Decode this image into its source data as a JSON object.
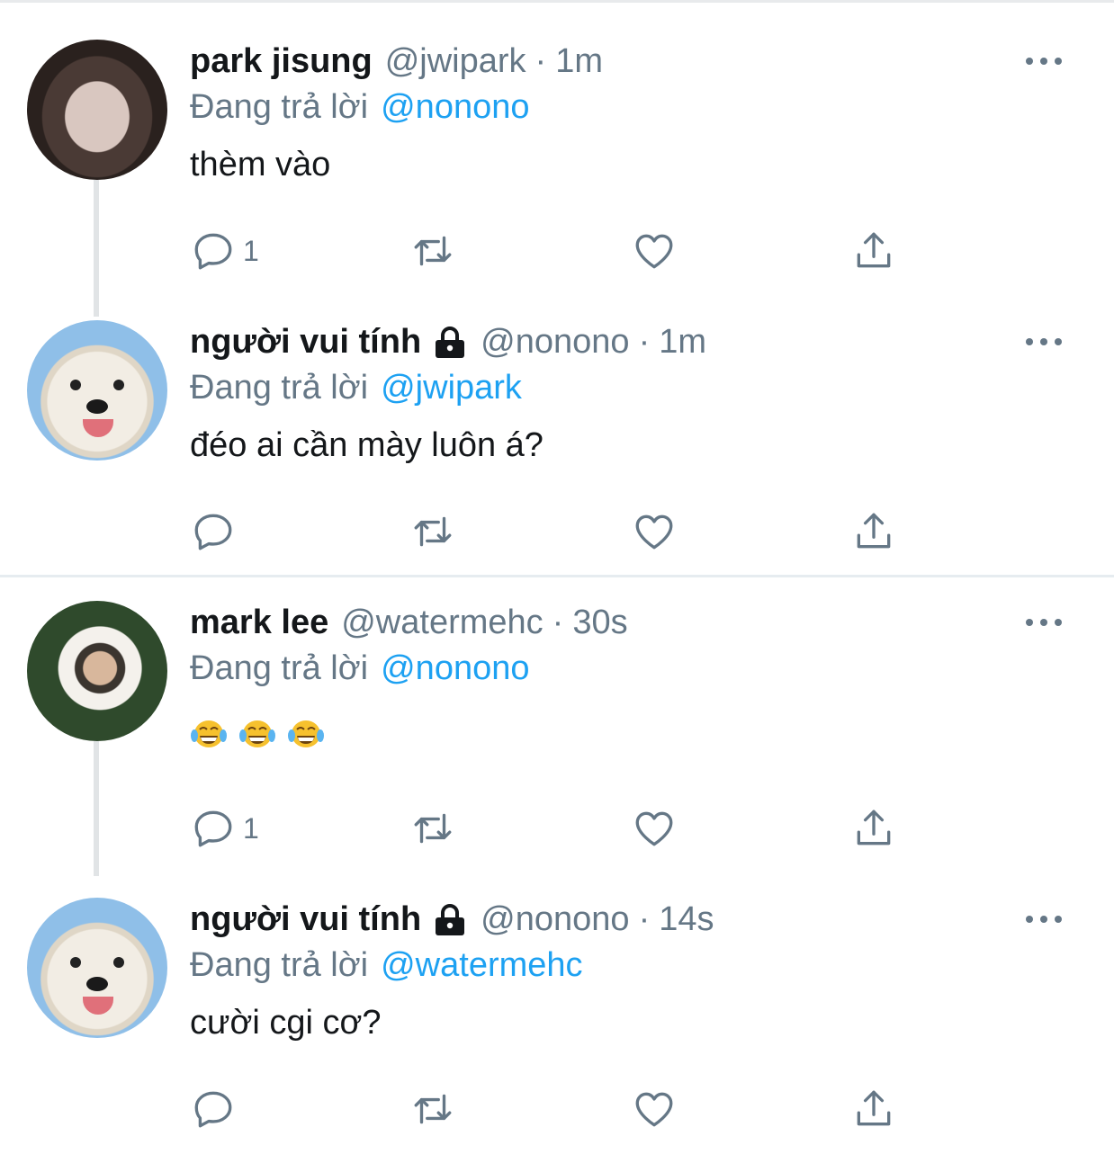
{
  "reply_prefix": "Đang trả lời",
  "tweets": [
    {
      "name": "park jisung",
      "handle": "@jwipark",
      "separator": "·",
      "time": "1m",
      "locked": false,
      "reply_to": "@nonono",
      "text": "thèm vào",
      "reply_count": "1",
      "avatar": "avatar-park-jisung"
    },
    {
      "name": "người vui tính",
      "handle": "@nonono",
      "separator": "·",
      "time": "1m",
      "locked": true,
      "reply_to": "@jwipark",
      "text": "đéo ai cần mày luôn á?",
      "reply_count": "",
      "avatar": "avatar-dog"
    },
    {
      "name": "mark lee",
      "handle": "@watermehc",
      "separator": "·",
      "time": "30s",
      "locked": false,
      "reply_to": "@nonono",
      "text": "",
      "emoji": [
        "face-with-tears-of-joy",
        "face-with-tears-of-joy",
        "face-with-tears-of-joy"
      ],
      "reply_count": "1",
      "avatar": "avatar-mark-lee"
    },
    {
      "name": "người vui tính",
      "handle": "@nonono",
      "separator": "·",
      "time": "14s",
      "locked": true,
      "reply_to": "@watermehc",
      "text": "cười cgi cơ?",
      "reply_count": "",
      "avatar": "avatar-dog"
    }
  ],
  "icons": {
    "reply": "reply-icon",
    "retweet": "retweet-icon",
    "like": "heart-icon",
    "share": "share-icon",
    "more": "more-icon",
    "lock": "lock-icon"
  },
  "colors": {
    "text": "#14171a",
    "secondary": "#657786",
    "mention": "#1da1f2",
    "divider": "#e6ecf0"
  }
}
